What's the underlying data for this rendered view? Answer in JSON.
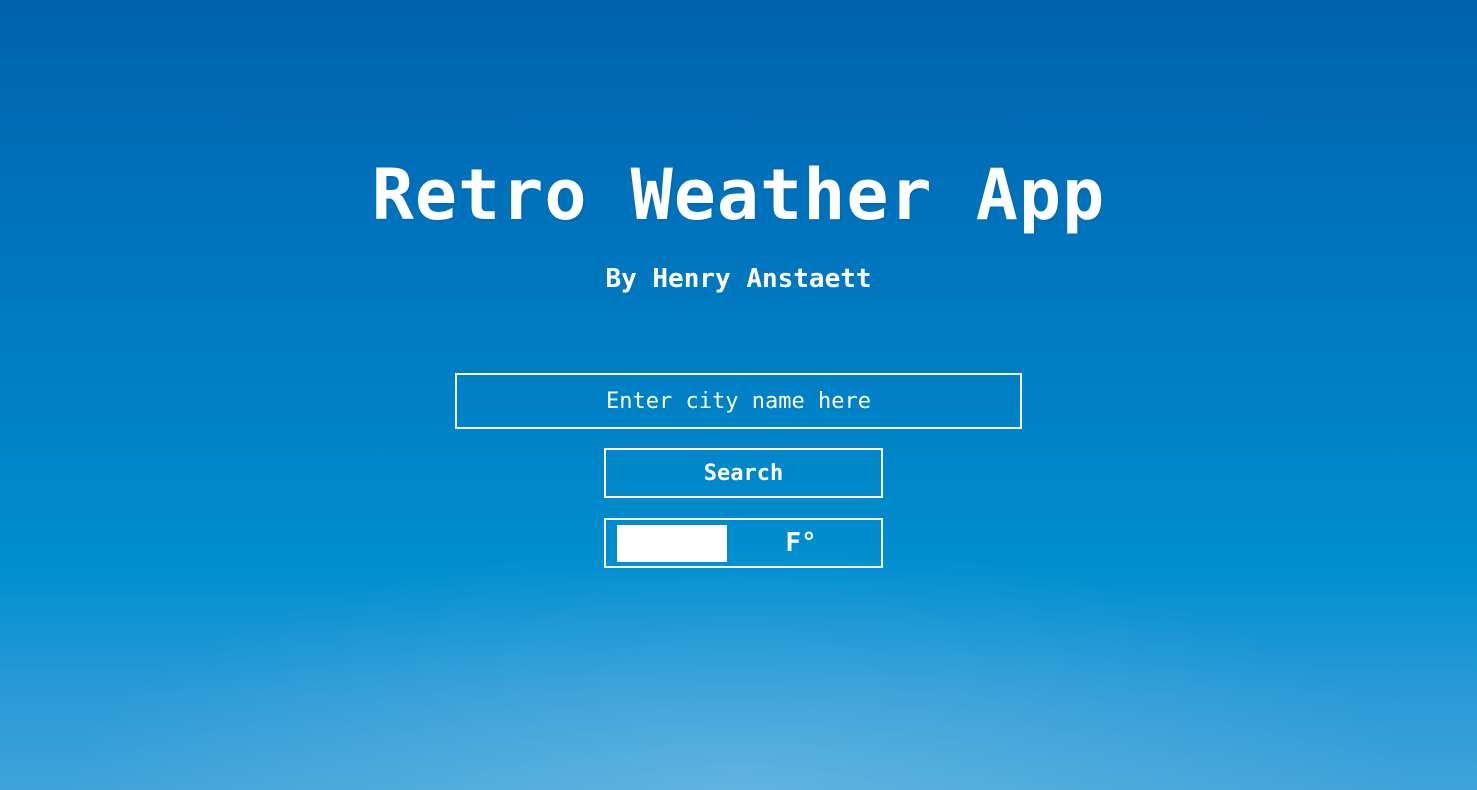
{
  "header": {
    "title": "Retro Weather App",
    "byline": "By Henry Anstaett"
  },
  "search": {
    "placeholder": "Enter city name here",
    "value": "",
    "button_label": "Search"
  },
  "unit_toggle": {
    "label": "F°",
    "selected": "F"
  },
  "colors": {
    "background_top": "#0062ad",
    "background_bottom": "#3fa3da",
    "foreground": "#ffffff"
  }
}
